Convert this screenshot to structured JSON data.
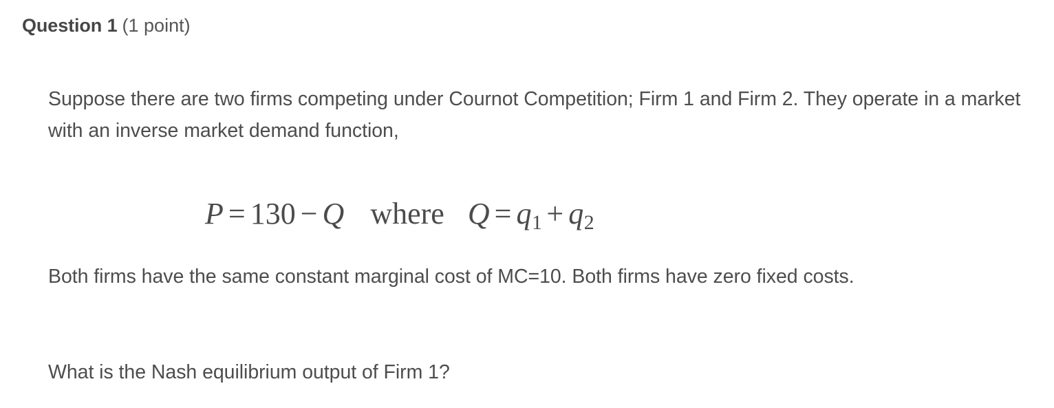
{
  "header": {
    "title": "Question 1",
    "points": "(1 point)"
  },
  "body": {
    "intro": "Suppose there are two firms competing under Cournot Competition; Firm 1 and Firm 2. They operate in a market with an inverse market demand function,",
    "equation": {
      "price_var": "P",
      "equals": "=",
      "intercept": "130",
      "minus": "−",
      "quantity_var": "Q",
      "where_word": "where",
      "total_var": "Q",
      "equals2": "=",
      "firm1_var": "q",
      "firm1_sub": "1",
      "plus": "+",
      "firm2_var": "q",
      "firm2_sub": "2",
      "plain_text": "P = 130 − Q   where   Q = q1 + q2"
    },
    "costs": "Both firms have the same constant marginal cost of MC=10. Both firms have zero fixed costs.",
    "ask": "What is the Nash equilibrium output of Firm 1?"
  },
  "colors": {
    "text": "#4d4d4d",
    "heading": "#464646",
    "background": "#ffffff"
  }
}
